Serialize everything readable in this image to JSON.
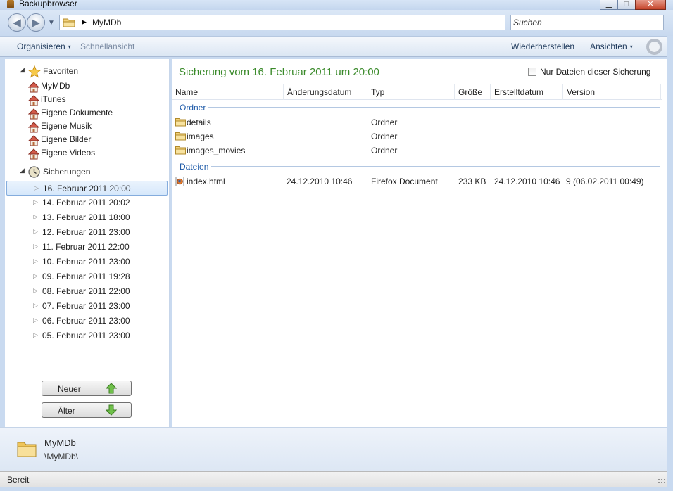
{
  "window": {
    "title": "Backupbrowser",
    "controls": {
      "minimize": "▁",
      "maximize": "□",
      "close": "✕"
    }
  },
  "nav": {
    "back_glyph": "◀",
    "forward_glyph": "▶",
    "dropdown_glyph": "▼",
    "breadcrumb_sep": "▶",
    "breadcrumb": "MyMDb",
    "search_placeholder": "Suchen"
  },
  "toolbar": {
    "organize_label": "Organisieren",
    "organize_caret": "▾",
    "quickview_label": "Schnellansicht",
    "restore_label": "Wiederherstellen",
    "views_label": "Ansichten",
    "views_caret": "▾"
  },
  "sidebar": {
    "favorites_label": "Favoriten",
    "favorites": [
      "MyMDb",
      "iTunes",
      "Eigene Dokumente",
      "Eigene Musik",
      "Eigene Bilder",
      "Eigene Videos"
    ],
    "backups_label": "Sicherungen",
    "backups": [
      "16. Februar 2011 20:00",
      "14. Februar 2011 20:02",
      "13. Februar 2011 18:00",
      "12. Februar 2011 23:00",
      "11. Februar 2011 22:00",
      "10. Februar 2011 23:00",
      "09. Februar 2011 19:28",
      "08. Februar 2011 22:00",
      "07. Februar 2011 23:00",
      "06. Februar 2011 23:00",
      "05. Februar 2011 23:00"
    ],
    "newer_label": "Neuer",
    "older_label": "Älter"
  },
  "main": {
    "title": "Sicherung vom 16. Februar 2011 um 20:00",
    "only_this_label": "Nur Dateien dieser Sicherung",
    "columns": {
      "name": "Name",
      "modified": "Änderungsdatum",
      "type": "Typ",
      "size": "Größe",
      "created": "Erstelltdatum",
      "version": "Version"
    },
    "folders_label": "Ordner",
    "folders": [
      {
        "name": "details",
        "type": "Ordner"
      },
      {
        "name": "images",
        "type": "Ordner"
      },
      {
        "name": "images_movies",
        "type": "Ordner"
      }
    ],
    "files_label": "Dateien",
    "files": [
      {
        "name": "index.html",
        "modified": "24.12.2010 10:46",
        "type": "Firefox Document",
        "size": "233 KB",
        "created": "24.12.2010 10:46",
        "version": "9 (06.02.2011 00:49)"
      }
    ]
  },
  "details": {
    "name": "MyMDb",
    "path": "\\MyMDb\\"
  },
  "status": {
    "text": "Bereit"
  },
  "colors": {
    "title_green": "#3a8a2a",
    "section_blue": "#1e5aa8",
    "selection": "#d6e8fb",
    "chrome": "#c9daf0"
  }
}
